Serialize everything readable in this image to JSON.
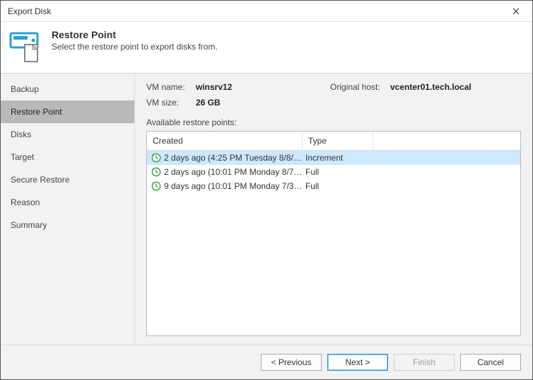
{
  "window": {
    "title": "Export Disk"
  },
  "header": {
    "title": "Restore Point",
    "subtitle": "Select the restore point to export disks from."
  },
  "sidebar": {
    "items": [
      {
        "label": "Backup",
        "active": false
      },
      {
        "label": "Restore Point",
        "active": true
      },
      {
        "label": "Disks",
        "active": false
      },
      {
        "label": "Target",
        "active": false
      },
      {
        "label": "Secure Restore",
        "active": false
      },
      {
        "label": "Reason",
        "active": false
      },
      {
        "label": "Summary",
        "active": false
      }
    ]
  },
  "vm": {
    "name_label": "VM name:",
    "name": "winsrv12",
    "host_label": "Original host:",
    "host": "vcenter01.tech.local",
    "size_label": "VM size:",
    "size": "26 GB"
  },
  "table": {
    "available_label": "Available restore points:",
    "col_created": "Created",
    "col_type": "Type",
    "rows": [
      {
        "created": "2 days ago (4:25 PM Tuesday 8/8/20...",
        "type": "Increment",
        "selected": true
      },
      {
        "created": "2 days ago (10:01 PM Monday 8/7/2...",
        "type": "Full",
        "selected": false
      },
      {
        "created": "9 days ago (10:01 PM Monday 7/31/...",
        "type": "Full",
        "selected": false
      }
    ]
  },
  "buttons": {
    "previous": "< Previous",
    "next": "Next >",
    "finish": "Finish",
    "cancel": "Cancel"
  }
}
